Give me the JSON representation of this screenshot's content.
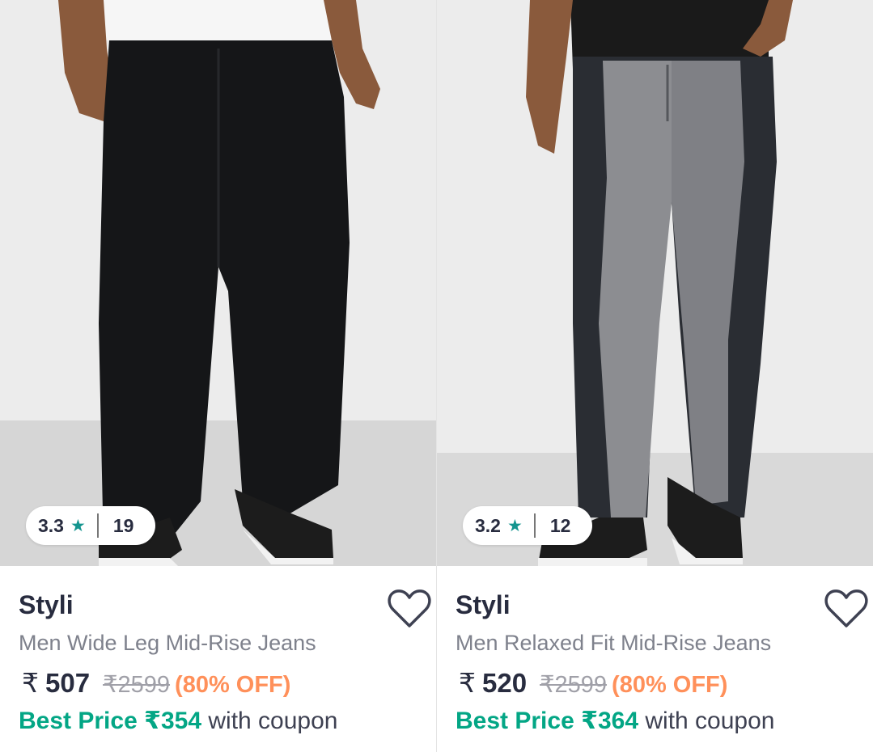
{
  "products": [
    {
      "rating": "3.3",
      "rating_icon": "star-icon",
      "review_count": "19",
      "brand": "Styli",
      "name": "Men Wide Leg Mid-Rise Jeans",
      "currency": "₹",
      "price": "507",
      "mrp": "₹2599",
      "discount": "(80% OFF)",
      "best_price": "Best Price ₹354",
      "coupon_text": "with coupon"
    },
    {
      "rating": "3.2",
      "rating_icon": "star-icon",
      "review_count": "12",
      "brand": "Styli",
      "name": "Men Relaxed Fit Mid-Rise Jeans",
      "currency": "₹",
      "price": "520",
      "mrp": "₹2599",
      "discount": "(80% OFF)",
      "best_price": "Best Price ₹364",
      "coupon_text": "with coupon"
    }
  ],
  "colors": {
    "rating_star": "#14958f",
    "discount": "#ff905a",
    "best_price": "#03a685",
    "text_primary": "#282c3f",
    "text_secondary": "#7e818c"
  }
}
